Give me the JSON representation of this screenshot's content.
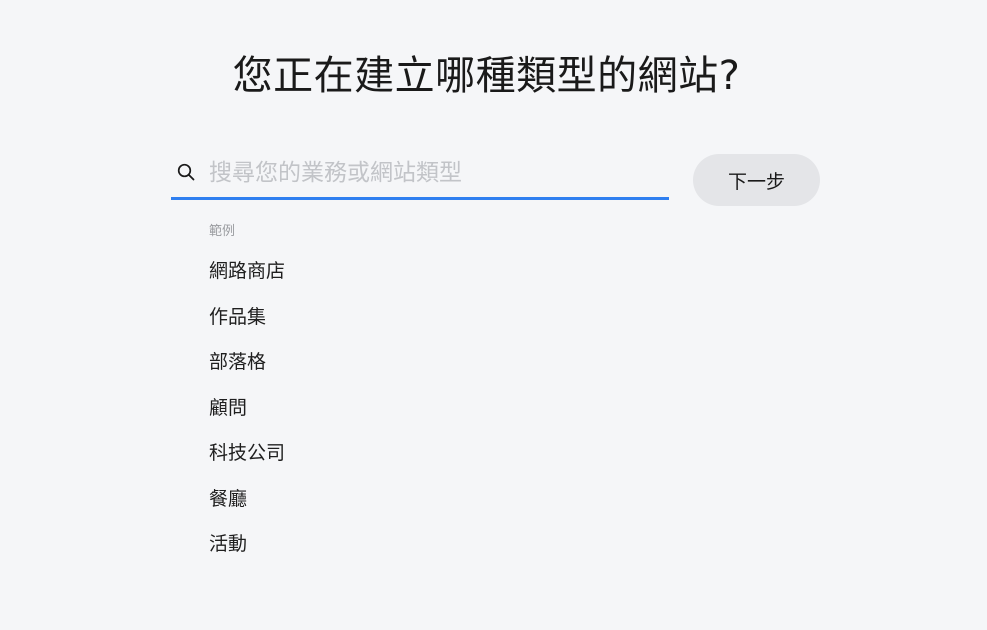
{
  "header": {
    "title": "您正在建立哪種類型的網站?"
  },
  "search": {
    "placeholder": "搜尋您的業務或網站類型",
    "value": "",
    "icon": "search-icon"
  },
  "actions": {
    "next_label": "下一步"
  },
  "examples": {
    "label": "範例",
    "items": [
      "網路商店",
      "作品集",
      "部落格",
      "顧問",
      "科技公司",
      "餐廳",
      "活動"
    ]
  },
  "colors": {
    "background": "#f5f6f8",
    "accent_underline": "#2f7ff0",
    "button_bg": "#e4e5e8",
    "placeholder": "#c2c4c8"
  }
}
